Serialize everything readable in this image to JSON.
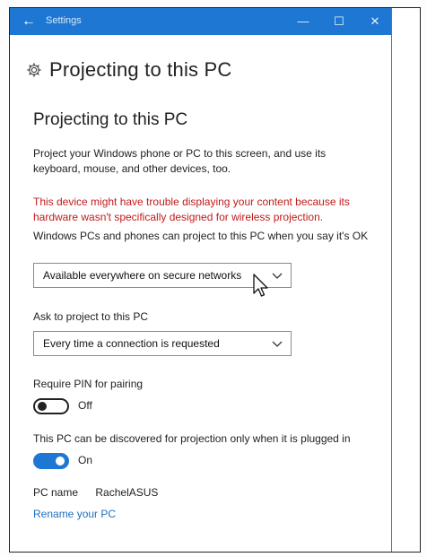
{
  "window": {
    "title": "Settings",
    "minimize": "—",
    "maximize": "☐",
    "close": "✕",
    "accent": "#1e78d3"
  },
  "page": {
    "title": "Projecting to this PC",
    "icon": "gear-icon"
  },
  "section": {
    "title": "Projecting to this PC",
    "description": "Project your Windows phone or PC to this screen, and use its keyboard, mouse, and other devices, too.",
    "warning": "This device might have trouble displaying your content because its hardware wasn't specifically designed for wireless projection.",
    "warning_color": "#c21b1b"
  },
  "availability": {
    "label": "Windows PCs and phones can project to this PC when you say it's OK",
    "selected": "Available everywhere on secure networks"
  },
  "ask": {
    "label": "Ask to project to this PC",
    "selected": "Every time a connection is requested"
  },
  "pin": {
    "label": "Require PIN for pairing",
    "state": "Off"
  },
  "plugged": {
    "label": "This PC can be discovered for projection only when it is plugged in",
    "state": "On"
  },
  "pc": {
    "name_label": "PC name",
    "name_value": "RachelASUS",
    "rename_link": "Rename your PC"
  }
}
